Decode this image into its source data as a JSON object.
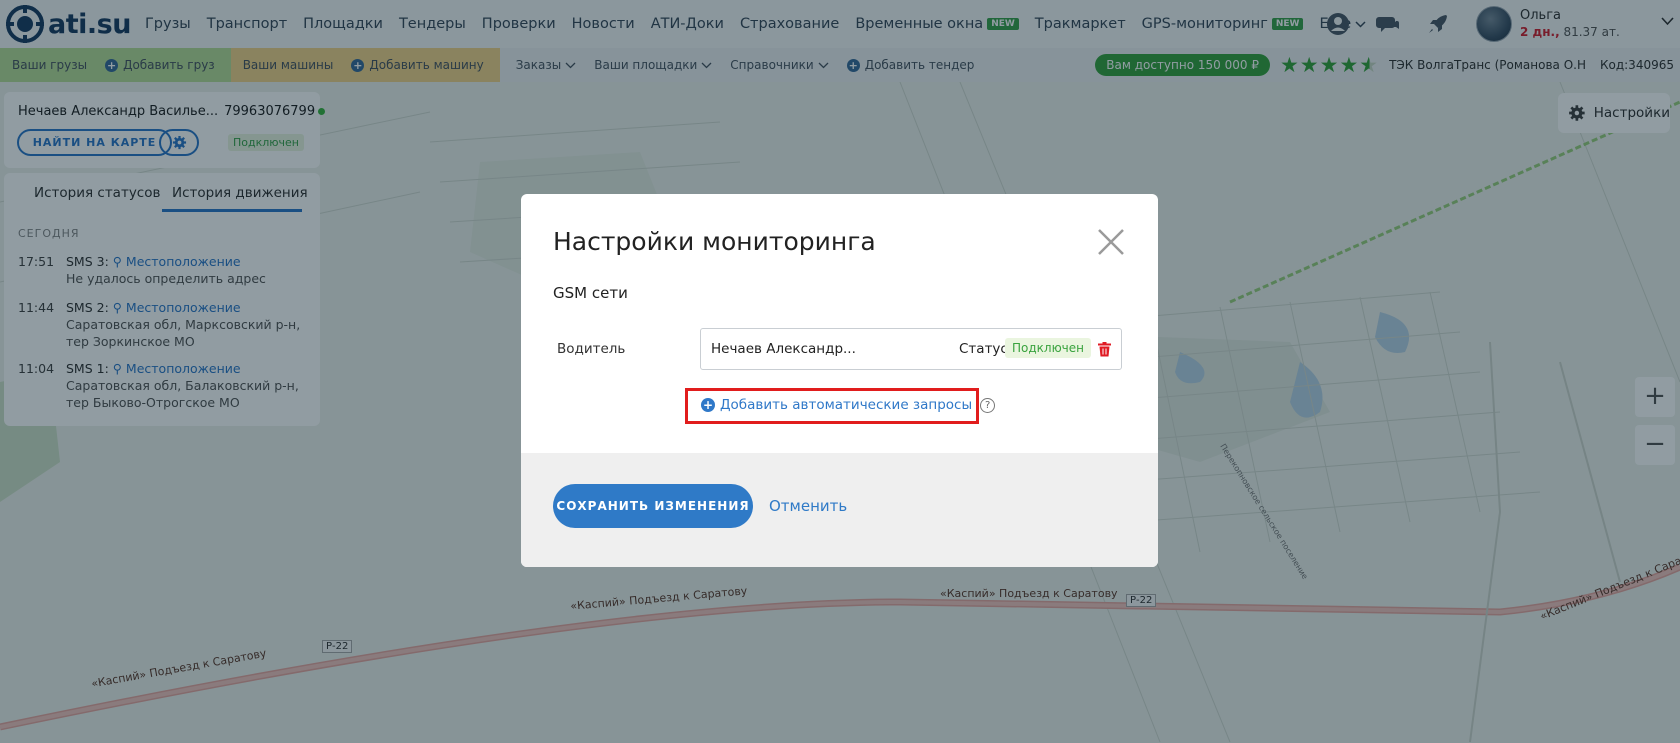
{
  "brand": {
    "logo_text": "ati.su"
  },
  "nav": {
    "links": [
      "Грузы",
      "Транспорт",
      "Площадки",
      "Тендеры",
      "Проверки",
      "Новости",
      "АТИ-Доки",
      "Страхование"
    ],
    "time_windows": "Временные окна",
    "new_badge": "NEW",
    "trackmarket": "Тракмаркет",
    "gps": "GPS-мониторинг",
    "more": "Еще"
  },
  "user": {
    "name": "Ольга",
    "days": "2 дн.,",
    "rest": " 81.37 ат."
  },
  "subnav": {
    "your_cargo": "Ваши грузы",
    "add_cargo": "Добавить груз",
    "your_vehicles": "Ваши машины",
    "add_vehicle": "Добавить машину",
    "orders": "Заказы",
    "your_platforms": "Ваши площадки",
    "references": "Справочники",
    "add_tender": "Добавить тендер",
    "available": "Вам доступно 150 000 ₽",
    "company": "ТЭК ВолгаТранс (Романова О.Н",
    "code": "Код:340965"
  },
  "left_panel": {
    "driver_name": "Нечаев Александр Василье...",
    "driver_phone": "79963076799",
    "find_on_map": "НАЙТИ НА КАРТЕ",
    "connected": "Подключен",
    "tab_status": "История статусов",
    "tab_movement": "История движения",
    "day": "СЕГОДНЯ",
    "history": [
      {
        "time": "17:51",
        "sms": "SMS 3:",
        "loc": "Местоположение",
        "addr": "Не удалось определить адрес"
      },
      {
        "time": "11:44",
        "sms": "SMS 2:",
        "loc": "Местоположение",
        "addr": "Саратовская обл, Марксовский р-н, тер Зоркинское МО"
      },
      {
        "time": "11:04",
        "sms": "SMS 1:",
        "loc": "Местоположение",
        "addr": "Саратовская обл, Балаковский р-н, тер Быково-Отрогское МО"
      }
    ]
  },
  "map": {
    "settings": "Настройки",
    "zoom_in": "+",
    "zoom_out": "−",
    "road1": "«Каспий» Подъезд к Саратову",
    "road2": "«Каспий» Подъезд к Саратову",
    "road3": "«Каспий» Подъезд к Саратову",
    "road4": "«Каспий» Подъезд к Сара",
    "shield": "Р-22",
    "settlement": "Перекопновское сельское поселение"
  },
  "modal": {
    "title": "Настройки мониторинга",
    "section": "GSM сети",
    "field_label": "Водитель",
    "field_value": "Нечаев Александр...",
    "status_label": "Статус",
    "status_badge": "Подключен",
    "add_auto": "Добавить автоматические запросы",
    "help": "?",
    "save": "СОХРАНИТЬ ИЗМЕНЕНИЯ",
    "cancel": "Отменить"
  }
}
